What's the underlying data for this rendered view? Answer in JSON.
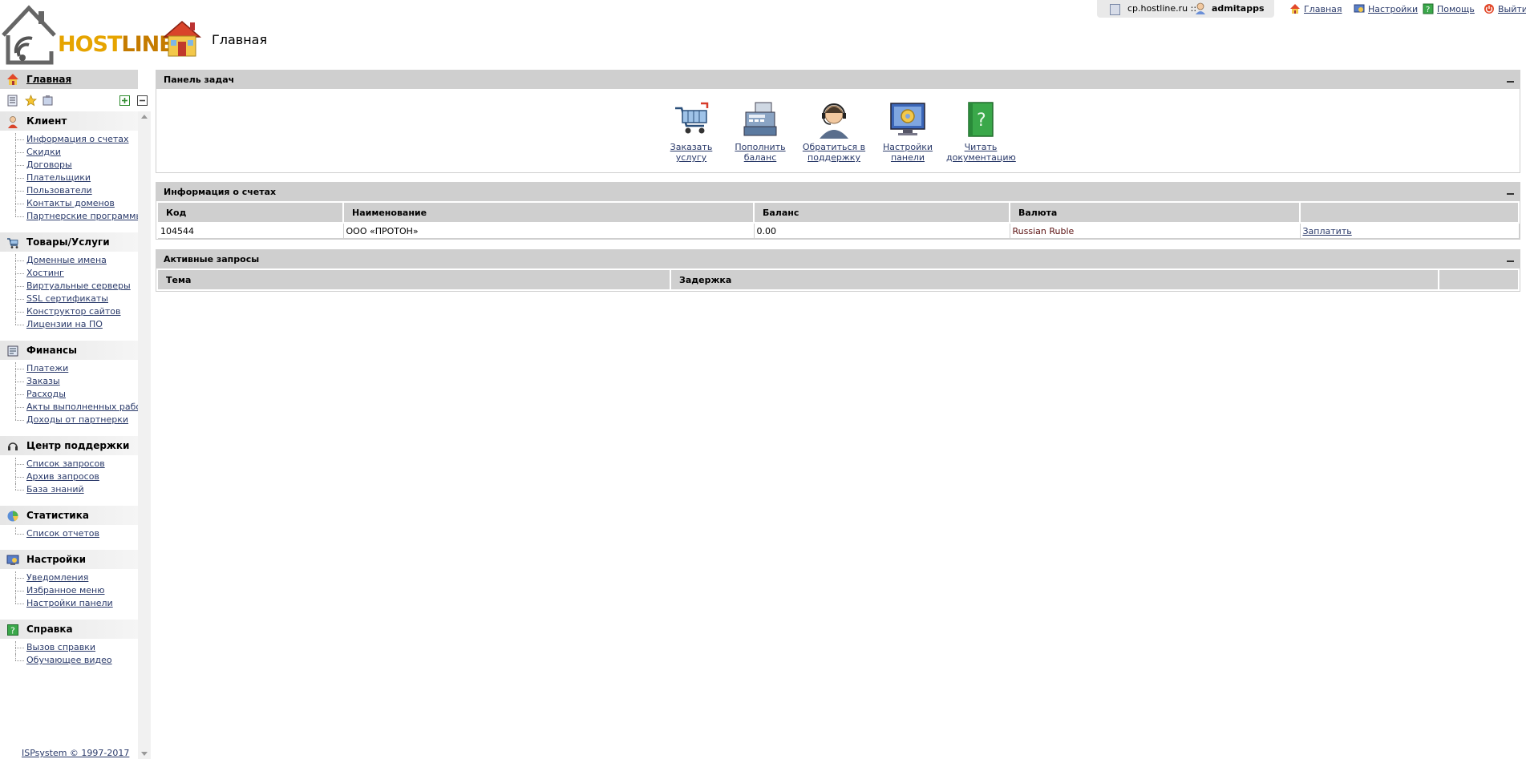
{
  "header": {
    "logo_host": "HOST",
    "logo_line": "LINE",
    "page_title": "Главная",
    "server": "cp.hostline.ru ::",
    "user": "admitapps",
    "links": [
      {
        "label": "Главная",
        "icon": "home-icon"
      },
      {
        "label": "Настройки",
        "icon": "settings-icon"
      },
      {
        "label": "Помощь",
        "icon": "help-icon"
      },
      {
        "label": "Выйти",
        "icon": "power-icon"
      }
    ]
  },
  "sidebar": {
    "home_label": "Главная",
    "sections": [
      {
        "title": "Клиент",
        "icon": "client-icon",
        "items": [
          "Информация о счетах",
          "Скидки",
          "Договоры",
          "Плательщики",
          "Пользователи",
          "Контакты доменов",
          "Партнерские программы"
        ]
      },
      {
        "title": "Товары/Услуги",
        "icon": "cart-icon",
        "items": [
          "Доменные имена",
          "Хостинг",
          "Виртуальные серверы",
          "SSL сертификаты",
          "Конструктор сайтов",
          "Лицензии на ПО"
        ]
      },
      {
        "title": "Финансы",
        "icon": "finance-icon",
        "items": [
          "Платежи",
          "Заказы",
          "Расходы",
          "Акты выполненных работ",
          "Доходы от партнерки"
        ]
      },
      {
        "title": "Центр поддержки",
        "icon": "headset-icon",
        "items": [
          "Список запросов",
          "Архив запросов",
          "База знаний"
        ]
      },
      {
        "title": "Статистика",
        "icon": "stats-icon",
        "items": [
          "Список отчетов"
        ]
      },
      {
        "title": "Настройки",
        "icon": "settings-icon",
        "items": [
          "Уведомления",
          "Избранное меню",
          "Настройки панели"
        ]
      },
      {
        "title": "Справка",
        "icon": "help-icon",
        "items": [
          "Вызов справки",
          "Обучающее видео"
        ]
      }
    ],
    "footer": "ISPsystem © 1997-2017"
  },
  "tasks": {
    "title": "Панель задач",
    "items": [
      {
        "line1": "Заказать услугу",
        "line2": "",
        "icon": "cart-icon"
      },
      {
        "line1": "Пополнить",
        "line2": "баланс",
        "icon": "cash-register-icon"
      },
      {
        "line1": "Обратиться в",
        "line2": "поддержку",
        "icon": "support-agent-icon"
      },
      {
        "line1": "Настройки",
        "line2": "панели",
        "icon": "monitor-gear-icon"
      },
      {
        "line1": "Читать",
        "line2": "документацию",
        "icon": "book-help-icon"
      }
    ]
  },
  "accounts": {
    "title": "Информация о счетах",
    "columns": [
      "Код",
      "Наименование",
      "Баланс",
      "Валюта",
      ""
    ],
    "rows": [
      {
        "code": "104544",
        "name": "ООО «ПРОТОН»",
        "balance": "0.00",
        "currency": "Russian Ruble",
        "action": "Заплатить"
      }
    ]
  },
  "requests": {
    "title": "Активные запросы",
    "columns": [
      "Тема",
      "Задержка",
      ""
    ]
  }
}
